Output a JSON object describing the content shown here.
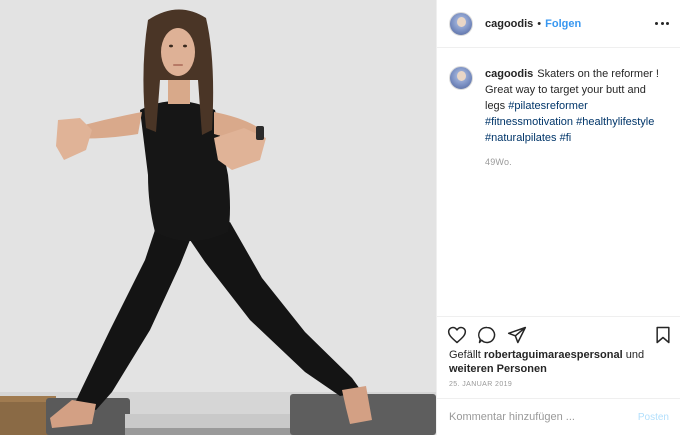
{
  "post": {
    "username": "cagoodis",
    "separator": "•",
    "follow_label": "Folgen",
    "caption_user": "cagoodis",
    "caption_text": "Skaters on the reformer ! Great way to target your butt and legs",
    "caption_tags": "#pilatesreformer #fitnessmotivation #healthylifestyle #naturalpilates #fi",
    "caption_time": "49Wo.",
    "likes_prefix": "Gefällt",
    "likes_user": "robertaguimaraespersonal",
    "likes_mid": "und",
    "likes_rest": "weiteren Personen",
    "date": "25. Januar 2019",
    "comment_placeholder": "Kommentar hinzufügen ...",
    "post_button": "Posten"
  },
  "icons": {
    "more": "more-options-icon",
    "like": "heart-icon",
    "comment": "comment-icon",
    "share": "send-icon",
    "save": "bookmark-icon"
  },
  "colors": {
    "link_blue": "#3897f0",
    "hashtag": "#003569",
    "muted": "#999999",
    "post_disabled": "#b2dffc"
  }
}
